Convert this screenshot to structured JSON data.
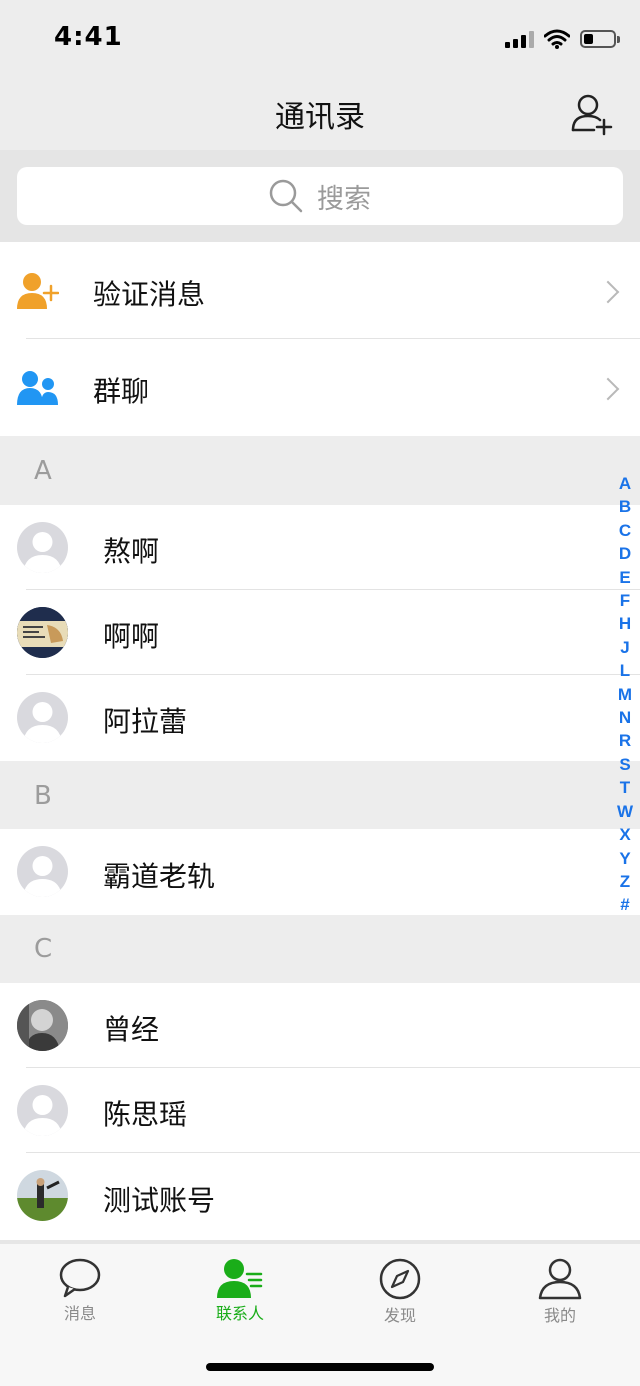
{
  "status_bar": {
    "time": "4:41"
  },
  "nav": {
    "title": "通讯录"
  },
  "search": {
    "placeholder": "搜索"
  },
  "functions": [
    {
      "label": "验证消息",
      "icon": "add-user-icon",
      "color": "#f0a12a"
    },
    {
      "label": "群聊",
      "icon": "group-icon",
      "color": "#2196f3"
    }
  ],
  "sections": [
    {
      "letter": "A",
      "contacts": [
        {
          "name": "熬啊",
          "avatar": "default-avatar"
        },
        {
          "name": "啊啊",
          "avatar": "photo-avatar"
        },
        {
          "name": "阿拉蕾",
          "avatar": "default-avatar"
        }
      ]
    },
    {
      "letter": "B",
      "contacts": [
        {
          "name": "霸道老轨",
          "avatar": "default-avatar"
        }
      ]
    },
    {
      "letter": "C",
      "contacts": [
        {
          "name": "曾经",
          "avatar": "photo-avatar"
        },
        {
          "name": "陈思瑶",
          "avatar": "default-avatar"
        },
        {
          "name": "测试账号",
          "avatar": "photo-avatar"
        }
      ]
    }
  ],
  "index_letters": [
    "A",
    "B",
    "C",
    "D",
    "E",
    "F",
    "H",
    "J",
    "L",
    "M",
    "N",
    "R",
    "S",
    "T",
    "W",
    "X",
    "Y",
    "Z",
    "#"
  ],
  "tabs": [
    {
      "label": "消息",
      "icon": "chat-bubble-icon"
    },
    {
      "label": "联系人",
      "icon": "contacts-icon",
      "active": true
    },
    {
      "label": "发现",
      "icon": "compass-icon"
    },
    {
      "label": "我的",
      "icon": "person-icon"
    }
  ],
  "colors": {
    "accent": "#1aad19",
    "index": "#1a73e8",
    "background": "#ededed"
  }
}
